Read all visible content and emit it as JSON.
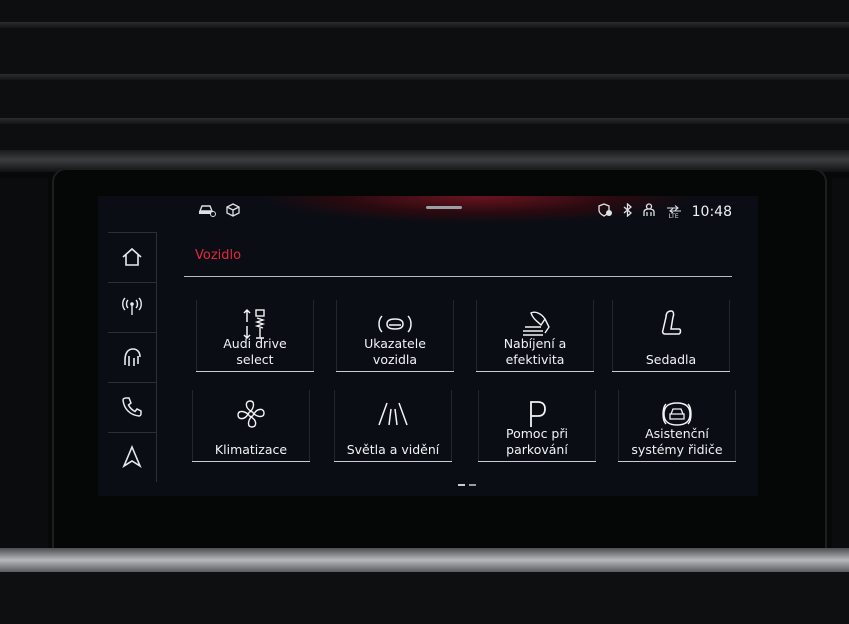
{
  "status_bar": {
    "left_icons": [
      "car-status-icon",
      "package-icon"
    ],
    "right_icons": [
      "shield-icon",
      "bluetooth-icon",
      "person-icon",
      "signal-lte-icon"
    ],
    "lte_label": "LTE",
    "time": "10:48"
  },
  "nav": {
    "items": [
      {
        "icon": "home-icon"
      },
      {
        "icon": "radio-icon"
      },
      {
        "icon": "music-icon"
      },
      {
        "icon": "phone-icon"
      },
      {
        "icon": "navigation-icon"
      }
    ]
  },
  "section": {
    "title": "Vozidlo"
  },
  "tiles": [
    {
      "icon": "suspension-icon",
      "line1": "Audi drive",
      "line2": "select"
    },
    {
      "icon": "car-indicator-icon",
      "line1": "Ukazatele",
      "line2": "vozidla"
    },
    {
      "icon": "charging-icon",
      "line1": "Nabíjení a",
      "line2": "efektivita"
    },
    {
      "icon": "seat-icon",
      "line1": "",
      "line2": "Sedadla"
    },
    {
      "icon": "fan-icon",
      "line1": "",
      "line2": "Klimatizace"
    },
    {
      "icon": "lights-icon",
      "line1": "",
      "line2": "Světla a vidění"
    },
    {
      "icon": "parking-icon",
      "line1": "Pomoc při",
      "line2": "parkování"
    },
    {
      "icon": "assistance-icon",
      "line1": "Asistenční",
      "line2": "systémy řidiče"
    }
  ],
  "pagination": {
    "pages": 2,
    "current": 1
  },
  "colors": {
    "accent": "#e3283c",
    "screen_background": "#0a0d14",
    "text": "#f1f3f5"
  }
}
